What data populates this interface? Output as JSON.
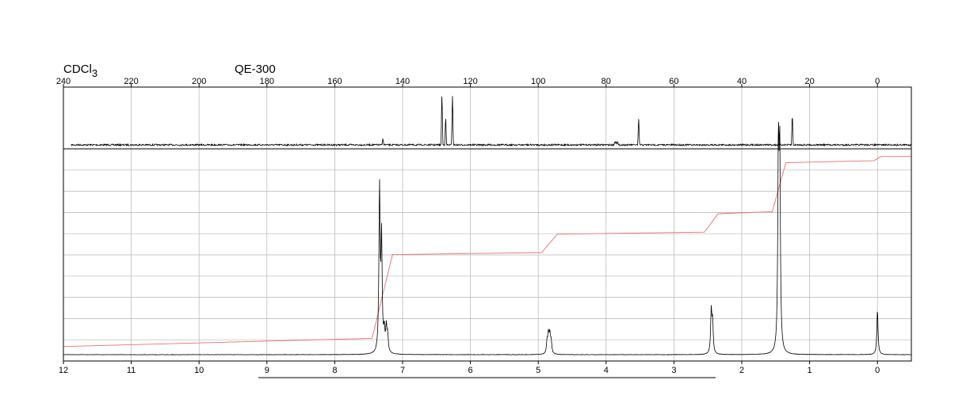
{
  "header": {
    "solvent": "CDCl",
    "solvent_sub": "3",
    "instrument": "QE-300"
  },
  "colors": {
    "spectrum": "#000000",
    "integral": "#e87070",
    "grid": "#b4b4b4"
  },
  "chart_data": [
    {
      "type": "line",
      "name": "13C spectrum",
      "x_axis": {
        "direction": "reversed",
        "range": [
          240,
          -10
        ],
        "ticks": [
          240,
          220,
          200,
          180,
          160,
          140,
          120,
          100,
          80,
          60,
          40,
          20,
          0
        ]
      },
      "grid": true,
      "peaks": [
        {
          "ppm": 145.8,
          "height": 0.12
        },
        {
          "ppm": 128.4,
          "height": 0.97
        },
        {
          "ppm": 127.3,
          "height": 0.52
        },
        {
          "ppm": 125.3,
          "height": 0.92
        },
        {
          "ppm": 77.4,
          "height": 0.06
        },
        {
          "ppm": 77.0,
          "height": 0.06
        },
        {
          "ppm": 76.6,
          "height": 0.06
        },
        {
          "ppm": 70.4,
          "height": 0.5
        },
        {
          "ppm": 25.1,
          "height": 0.58
        }
      ]
    },
    {
      "type": "line",
      "name": "1H spectrum",
      "x_axis": {
        "direction": "reversed",
        "range": [
          12,
          -0.5
        ],
        "ticks": [
          12,
          11,
          10,
          9,
          8,
          7,
          6,
          5,
          4,
          3,
          2,
          1,
          0
        ]
      },
      "grid": true,
      "peaks": [
        {
          "ppm": 7.34,
          "height": 0.8
        },
        {
          "ppm": 7.31,
          "height": 0.55
        },
        {
          "ppm": 7.27,
          "height": 0.1
        },
        {
          "ppm": 7.24,
          "height": 0.12
        },
        {
          "ppm": 7.22,
          "height": 0.08
        },
        {
          "ppm": 4.87,
          "height": 0.06
        },
        {
          "ppm": 4.85,
          "height": 0.09
        },
        {
          "ppm": 4.83,
          "height": 0.09
        },
        {
          "ppm": 4.81,
          "height": 0.06
        },
        {
          "ppm": 2.45,
          "height": 0.21
        },
        {
          "ppm": 2.43,
          "height": 0.15
        },
        {
          "ppm": 1.46,
          "height": 0.96
        },
        {
          "ppm": 1.44,
          "height": 0.93
        },
        {
          "ppm": 0.0,
          "height": 0.22
        }
      ],
      "integral": [
        {
          "ppm": 12.0,
          "level": 0.04
        },
        {
          "ppm": 7.45,
          "level": 0.08
        },
        {
          "ppm": 7.15,
          "level": 0.49
        },
        {
          "ppm": 4.95,
          "level": 0.5
        },
        {
          "ppm": 4.72,
          "level": 0.59
        },
        {
          "ppm": 2.55,
          "level": 0.6
        },
        {
          "ppm": 2.35,
          "level": 0.69
        },
        {
          "ppm": 1.55,
          "level": 0.7
        },
        {
          "ppm": 1.35,
          "level": 0.94
        },
        {
          "ppm": 0.05,
          "level": 0.95
        },
        {
          "ppm": -0.05,
          "level": 0.97
        },
        {
          "ppm": -0.5,
          "level": 0.97
        }
      ]
    }
  ]
}
